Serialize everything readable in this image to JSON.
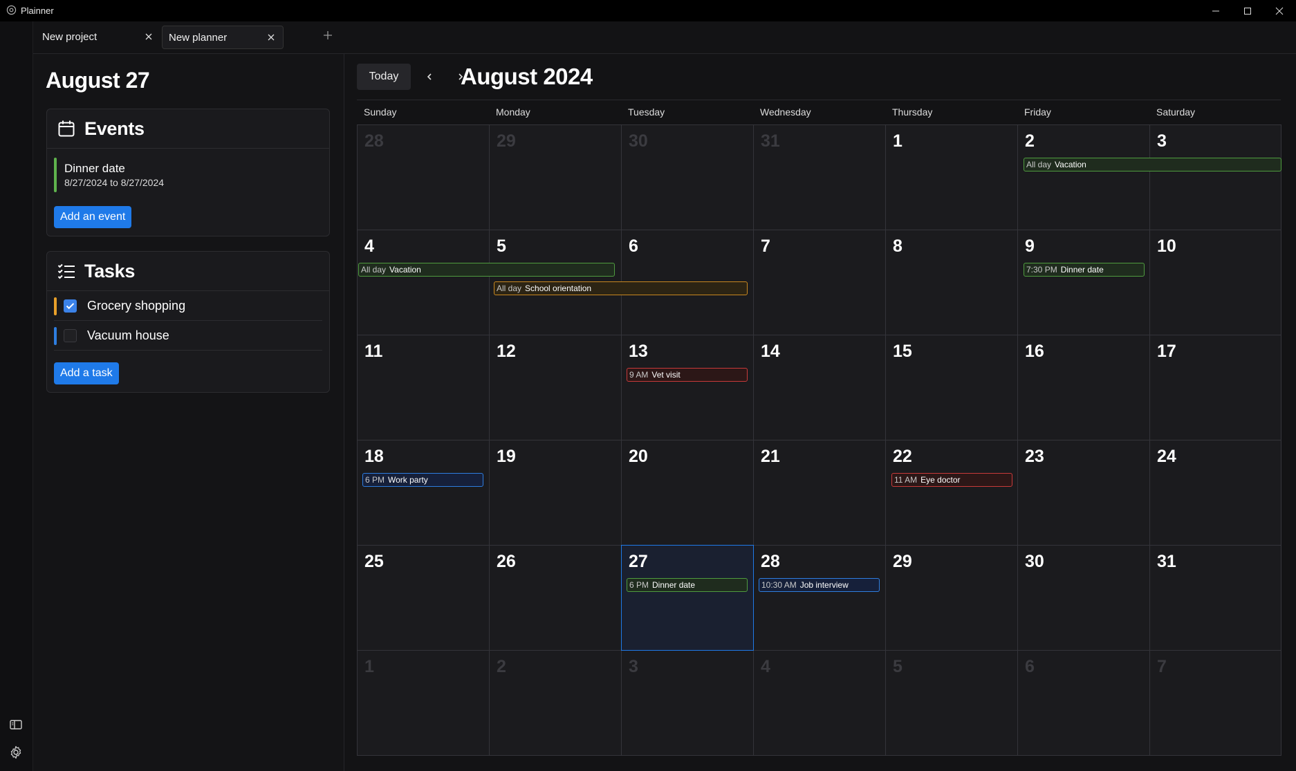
{
  "window": {
    "title": "Plainner"
  },
  "tabs": [
    {
      "label": "New project"
    },
    {
      "label": "New planner"
    }
  ],
  "sidebar": {
    "date": "August 27",
    "events": {
      "title": "Events",
      "items": [
        {
          "name": "Dinner date",
          "range": "8/27/2024 to 8/27/2024",
          "color": "#5fb34d"
        }
      ],
      "add_label": "Add an event"
    },
    "tasks": {
      "title": "Tasks",
      "items": [
        {
          "label": "Grocery shopping",
          "checked": true,
          "color": "#e8a02a"
        },
        {
          "label": "Vacuum house",
          "checked": false,
          "color": "#2e7ee0"
        }
      ],
      "add_label": "Add a task"
    }
  },
  "calendar": {
    "today_label": "Today",
    "month_title": "August 2024",
    "weekdays": [
      "Sunday",
      "Monday",
      "Tuesday",
      "Wednesday",
      "Thursday",
      "Friday",
      "Saturday"
    ],
    "days": [
      "28",
      "29",
      "30",
      "31",
      "1",
      "2",
      "3",
      "4",
      "5",
      "6",
      "7",
      "8",
      "9",
      "10",
      "11",
      "12",
      "13",
      "14",
      "15",
      "16",
      "17",
      "18",
      "19",
      "20",
      "21",
      "22",
      "23",
      "24",
      "25",
      "26",
      "27",
      "28",
      "29",
      "30",
      "31",
      "1",
      "2",
      "3",
      "4",
      "5",
      "6",
      "7"
    ],
    "events": [
      {
        "time": "All day",
        "title": "Vacation",
        "color": "green"
      },
      {
        "time": "All day",
        "title": "Vacation",
        "color": "green"
      },
      {
        "time": "All day",
        "title": "School orientation",
        "color": "orange"
      },
      {
        "time": "7:30 PM",
        "title": "Dinner date",
        "color": "green"
      },
      {
        "time": "9 AM",
        "title": "Vet visit",
        "color": "red"
      },
      {
        "time": "6 PM",
        "title": "Work party",
        "color": "blue"
      },
      {
        "time": "11 AM",
        "title": "Eye doctor",
        "color": "red"
      },
      {
        "time": "6 PM",
        "title": "Dinner date",
        "color": "green"
      },
      {
        "time": "10:30 AM",
        "title": "Job interview",
        "color": "blue"
      }
    ]
  },
  "icons": [
    "app-icon",
    "minimize-icon",
    "maximize-icon",
    "close-icon",
    "tab-close-icon",
    "plus-icon",
    "calendar-icon",
    "checklist-icon",
    "check-icon",
    "chevron-left-icon",
    "chevron-right-icon",
    "sidebar-toggle-icon",
    "gear-icon"
  ]
}
